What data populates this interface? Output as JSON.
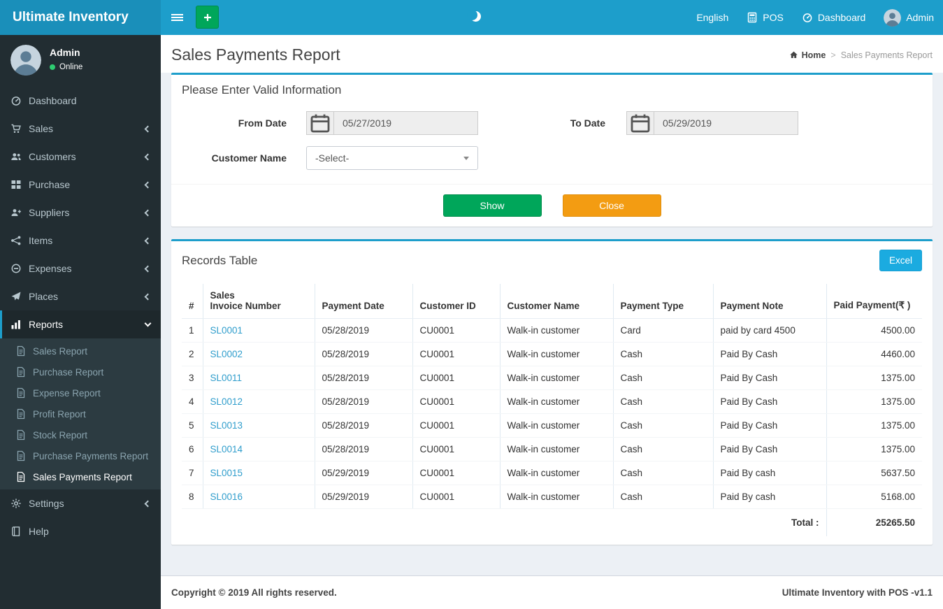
{
  "colors": {
    "accent": "#1d9ecb",
    "logo_bg": "#1a8fba",
    "green": "#00a65a",
    "orange": "#f39c12",
    "excel_blue": "#1babe0",
    "sidebar_bg": "#222d32"
  },
  "app": {
    "brand": "Ultimate Inventory"
  },
  "navbar": {
    "language": "English",
    "pos_label": "POS",
    "dashboard_label": "Dashboard",
    "user_name": "Admin"
  },
  "sidebar": {
    "user_name": "Admin",
    "user_status": "Online",
    "menu": [
      {
        "label": "Dashboard",
        "icon": "dashboard"
      },
      {
        "label": "Sales",
        "icon": "sales",
        "arrow": "left"
      },
      {
        "label": "Customers",
        "icon": "customers",
        "arrow": "left"
      },
      {
        "label": "Purchase",
        "icon": "purchase",
        "arrow": "left"
      },
      {
        "label": "Suppliers",
        "icon": "suppliers",
        "arrow": "left"
      },
      {
        "label": "Items",
        "icon": "items",
        "arrow": "left"
      },
      {
        "label": "Expenses",
        "icon": "expenses",
        "arrow": "left"
      },
      {
        "label": "Places",
        "icon": "places",
        "arrow": "left"
      },
      {
        "label": "Reports",
        "icon": "reports",
        "arrow": "down",
        "active": true,
        "children": [
          {
            "label": "Sales Report"
          },
          {
            "label": "Purchase Report"
          },
          {
            "label": "Expense Report"
          },
          {
            "label": "Profit Report"
          },
          {
            "label": "Stock Report"
          },
          {
            "label": "Purchase Payments Report"
          },
          {
            "label": "Sales Payments Report",
            "active": true
          }
        ]
      },
      {
        "label": "Settings",
        "icon": "settings",
        "arrow": "left"
      },
      {
        "label": "Help",
        "icon": "help"
      }
    ]
  },
  "page": {
    "title": "Sales Payments Report",
    "breadcrumb_home": "Home",
    "breadcrumb_current": "Sales Payments Report"
  },
  "filter_panel": {
    "title": "Please Enter Valid Information",
    "from_date_label": "From Date",
    "from_date_value": "05/27/2019",
    "to_date_label": "To Date",
    "to_date_value": "05/29/2019",
    "customer_label": "Customer Name",
    "customer_value": "-Select-",
    "show_button": "Show",
    "close_button": "Close"
  },
  "records_panel": {
    "title": "Records Table",
    "excel_button": "Excel",
    "table": {
      "headers": [
        "#",
        "Sales\nInvoice Number",
        "Payment Date",
        "Customer ID",
        "Customer Name",
        "Payment Type",
        "Payment Note",
        "Paid Payment(₹ )"
      ],
      "rows": [
        [
          "1",
          "SL0001",
          "05/28/2019",
          "CU0001",
          "Walk-in customer",
          "Card",
          "paid by card 4500",
          "4500.00"
        ],
        [
          "2",
          "SL0002",
          "05/28/2019",
          "CU0001",
          "Walk-in customer",
          "Cash",
          "Paid By Cash",
          "4460.00"
        ],
        [
          "3",
          "SL0011",
          "05/28/2019",
          "CU0001",
          "Walk-in customer",
          "Cash",
          "Paid By Cash",
          "1375.00"
        ],
        [
          "4",
          "SL0012",
          "05/28/2019",
          "CU0001",
          "Walk-in customer",
          "Cash",
          "Paid By Cash",
          "1375.00"
        ],
        [
          "5",
          "SL0013",
          "05/28/2019",
          "CU0001",
          "Walk-in customer",
          "Cash",
          "Paid By Cash",
          "1375.00"
        ],
        [
          "6",
          "SL0014",
          "05/28/2019",
          "CU0001",
          "Walk-in customer",
          "Cash",
          "Paid By Cash",
          "1375.00"
        ],
        [
          "7",
          "SL0015",
          "05/29/2019",
          "CU0001",
          "Walk-in customer",
          "Cash",
          "Paid By cash",
          "5637.50"
        ],
        [
          "8",
          "SL0016",
          "05/29/2019",
          "CU0001",
          "Walk-in customer",
          "Cash",
          "Paid By cash",
          "5168.00"
        ]
      ],
      "total_label": "Total :",
      "total_value": "25265.50"
    }
  },
  "footer": {
    "left": "Copyright © 2019 All rights reserved.",
    "right": "Ultimate Inventory with POS -v1.1"
  }
}
